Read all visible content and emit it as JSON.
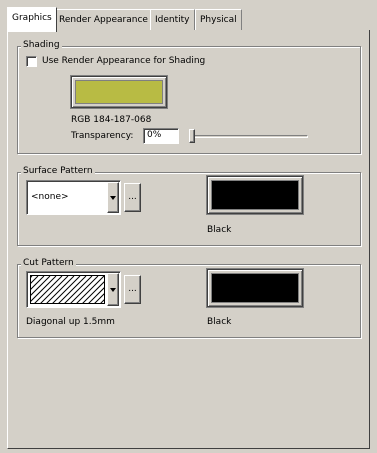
{
  "tabs": [
    {
      "label": "Graphics"
    },
    {
      "label": "Render Appearance"
    },
    {
      "label": "Identity"
    },
    {
      "label": "Physical"
    }
  ],
  "shading": {
    "legend": "Shading",
    "use_render_label": "Use Render Appearance for Shading",
    "use_render_checked": false,
    "color_hex": "#b8bb44",
    "rgb_text": "RGB 184-187-068",
    "transparency_label": "Transparency:",
    "transparency_value": "0%",
    "transparency_fraction": 0.0
  },
  "surface_pattern": {
    "legend": "Surface Pattern",
    "pattern_value": "<none>",
    "browse_label": "...",
    "color_hex": "#000000",
    "color_name": "Black"
  },
  "cut_pattern": {
    "legend": "Cut Pattern",
    "pattern_name": "Diagonal up 1.5mm",
    "browse_label": "...",
    "color_hex": "#000000",
    "color_name": "Black"
  },
  "icons": {
    "dropdown": "triangle-down",
    "slider_thumb": "slider-thumb"
  }
}
